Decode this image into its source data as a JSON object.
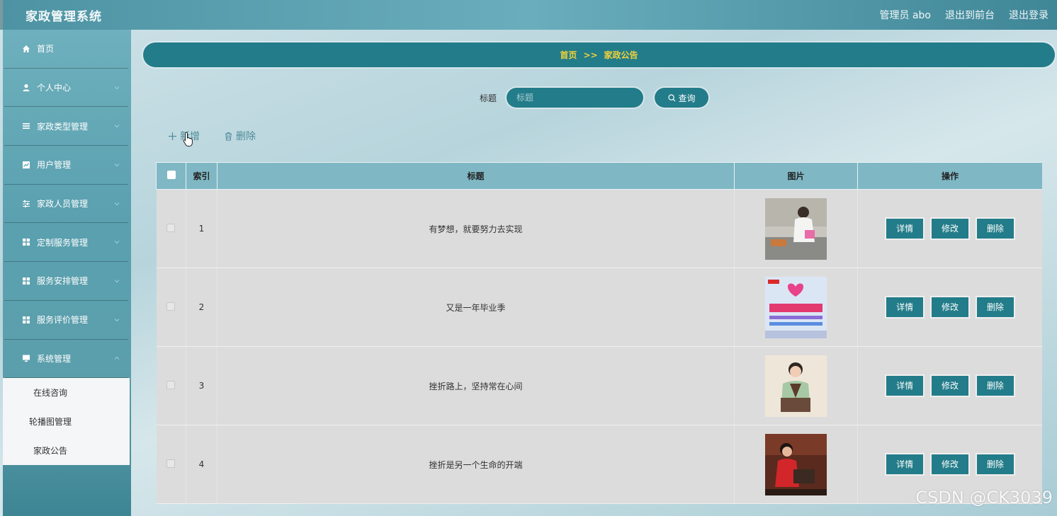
{
  "header": {
    "title": "家政管理系统",
    "user_label": "管理员 abo",
    "front_link": "退出到前台",
    "logout_link": "退出登录"
  },
  "sidebar": {
    "items": [
      {
        "label": "首页",
        "icon": "home-icon"
      },
      {
        "label": "个人中心",
        "icon": "user-icon"
      },
      {
        "label": "家政类型管理",
        "icon": "list-icon"
      },
      {
        "label": "用户管理",
        "icon": "chart-icon"
      },
      {
        "label": "家政人员管理",
        "icon": "sliders-icon"
      },
      {
        "label": "定制服务管理",
        "icon": "grid-icon"
      },
      {
        "label": "服务安排管理",
        "icon": "grid-icon"
      },
      {
        "label": "服务评价管理",
        "icon": "grid-icon"
      },
      {
        "label": "系统管理",
        "icon": "monitor-icon"
      }
    ],
    "submenu": [
      {
        "label": "在线咨询"
      },
      {
        "label": "轮播图管理"
      },
      {
        "label": "家政公告"
      }
    ]
  },
  "breadcrumb": {
    "home": "首页",
    "sep": ">>",
    "current": "家政公告"
  },
  "search": {
    "label": "标题",
    "placeholder": "标题",
    "button": "查询"
  },
  "actions": {
    "add": "新增",
    "delete": "删除"
  },
  "table": {
    "headers": {
      "index": "索引",
      "title": "标题",
      "image": "图片",
      "ops": "操作"
    },
    "op_labels": {
      "detail": "详情",
      "edit": "修改",
      "delete": "删除"
    },
    "rows": [
      {
        "index": "1",
        "title": "有梦想，就要努力去实现"
      },
      {
        "index": "2",
        "title": "又是一年毕业季"
      },
      {
        "index": "3",
        "title": "挫折路上，坚持常在心间"
      },
      {
        "index": "4",
        "title": "挫折是另一个生命的开端"
      }
    ]
  },
  "watermark": "CSDN @CK3039",
  "colors": {
    "primary": "#237c89",
    "accent_text": "#f0d23a",
    "table_header": "#7fb8c4"
  }
}
